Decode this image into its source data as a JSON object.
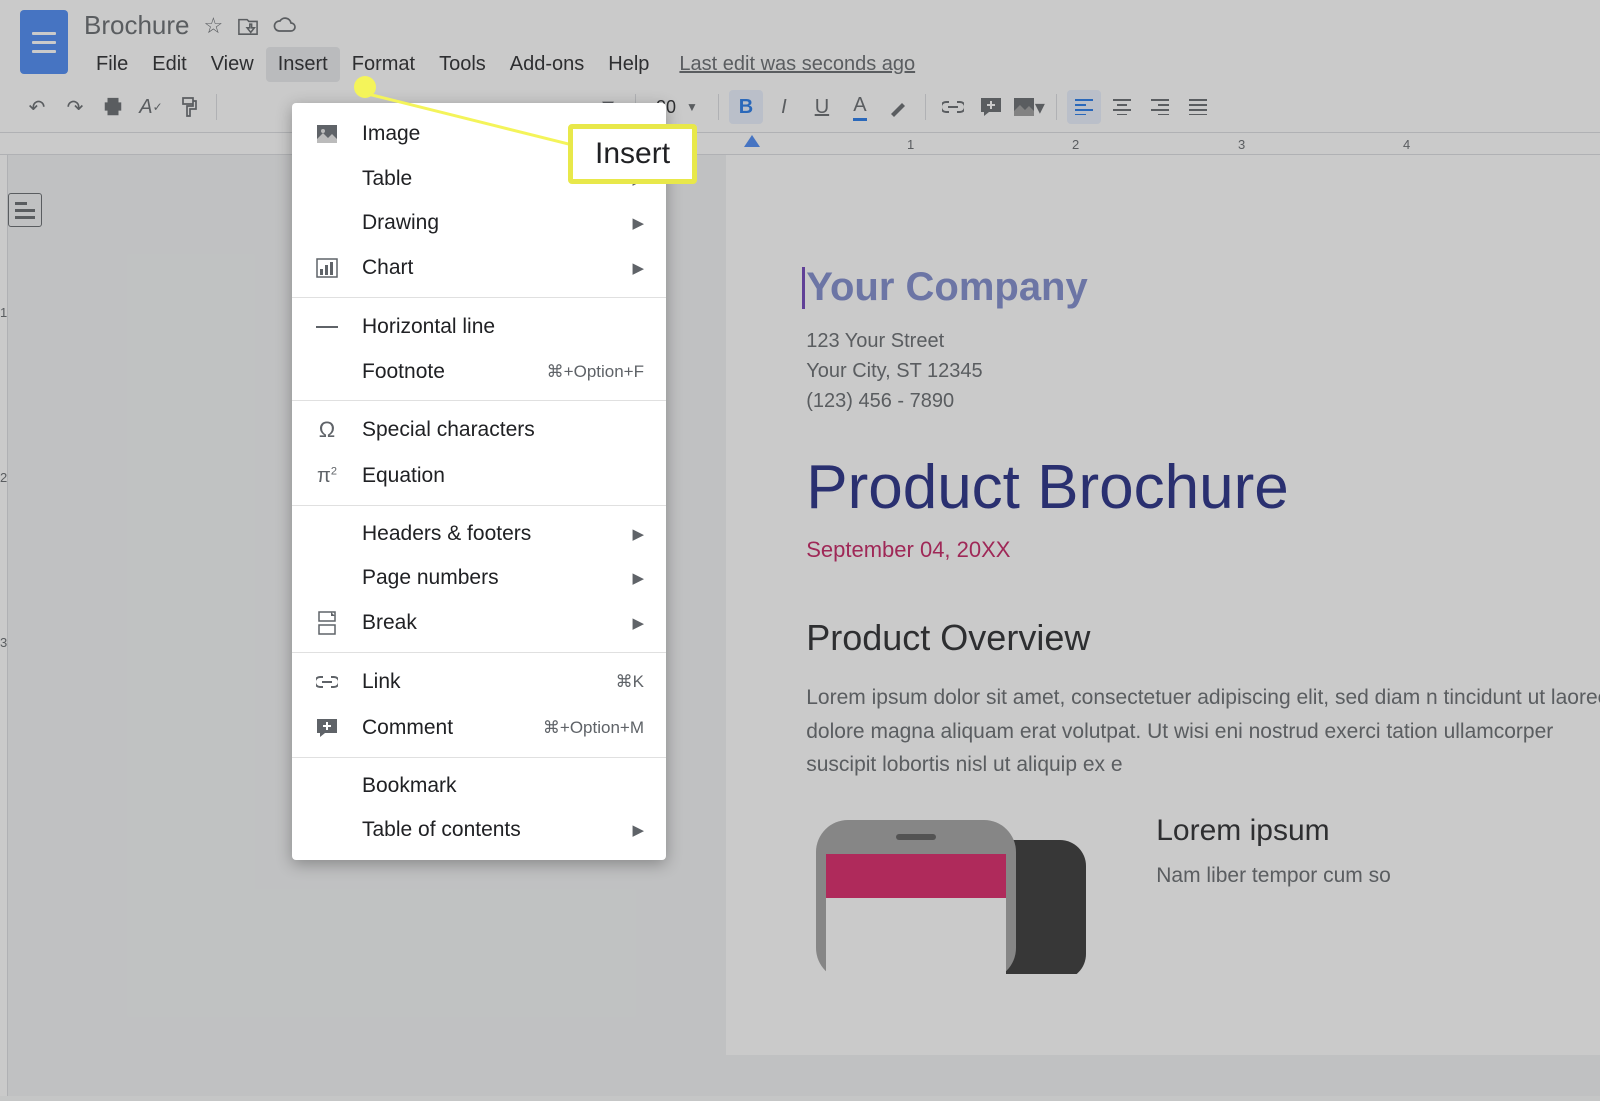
{
  "doc_title": "Brochure",
  "menubar": [
    "File",
    "Edit",
    "View",
    "Insert",
    "Format",
    "Tools",
    "Add-ons",
    "Help"
  ],
  "last_edit": "Last edit was seconds ago",
  "font_size": "20",
  "callout_label": "Insert",
  "ruler_h": [
    "1",
    "2",
    "3",
    "4"
  ],
  "ruler_v": [
    "1",
    "2",
    "3"
  ],
  "insert_menu": {
    "groups": [
      [
        {
          "icon": "image",
          "label": "Image",
          "arrow": true
        },
        {
          "icon": "",
          "label": "Table",
          "arrow": true
        },
        {
          "icon": "",
          "label": "Drawing",
          "arrow": true
        },
        {
          "icon": "chart",
          "label": "Chart",
          "arrow": true
        }
      ],
      [
        {
          "icon": "hline",
          "label": "Horizontal line"
        },
        {
          "icon": "",
          "label": "Footnote",
          "shortcut": "⌘+Option+F"
        }
      ],
      [
        {
          "icon": "omega",
          "label": "Special characters"
        },
        {
          "icon": "pi",
          "label": "Equation"
        }
      ],
      [
        {
          "icon": "",
          "label": "Headers & footers",
          "arrow": true
        },
        {
          "icon": "",
          "label": "Page numbers",
          "arrow": true
        },
        {
          "icon": "break",
          "label": "Break",
          "arrow": true
        }
      ],
      [
        {
          "icon": "link",
          "label": "Link",
          "shortcut": "⌘K"
        },
        {
          "icon": "comment",
          "label": "Comment",
          "shortcut": "⌘+Option+M"
        }
      ],
      [
        {
          "icon": "",
          "label": "Bookmark"
        },
        {
          "icon": "",
          "label": "Table of contents",
          "arrow": true
        }
      ]
    ]
  },
  "document": {
    "company": "Your Company",
    "address1": "123 Your Street",
    "address2": "Your City, ST 12345",
    "phone": "(123) 456 - 7890",
    "title": "Product Brochure",
    "date": "September 04, 20XX",
    "overview_hdr": "Product Overview",
    "overview_body": "Lorem ipsum dolor sit amet, consectetuer adipiscing elit, sed diam n tincidunt ut laoreet dolore magna aliquam erat volutpat. Ut wisi eni nostrud exerci tation ullamcorper suscipit lobortis nisl ut aliquip ex e",
    "side_hdr": "Lorem ipsum",
    "side_body": "Nam liber tempor cum so"
  }
}
